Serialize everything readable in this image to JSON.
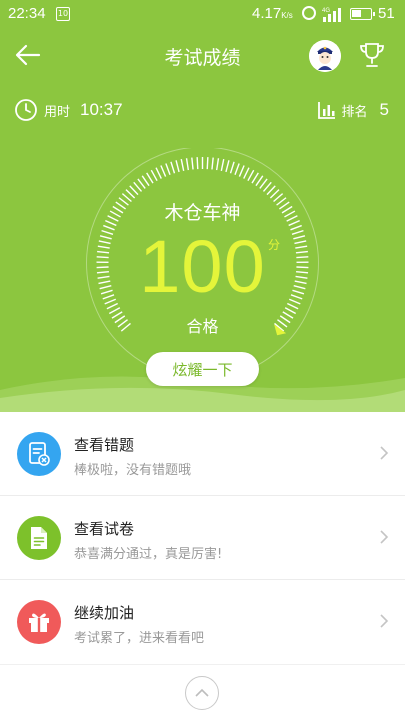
{
  "status_bar": {
    "time": "22:34",
    "notification_badge": "10",
    "speed": "4.17",
    "speed_unit": "K/s",
    "network": "4G",
    "battery_level": "51",
    "battery_percent": 51
  },
  "header": {
    "title": "考试成绩",
    "back_icon": "arrow-left-icon",
    "avatar_icon": "avatar",
    "trophy_icon": "trophy-icon"
  },
  "stats": {
    "time_label": "用时",
    "time_value": "10:37",
    "rank_label": "排名",
    "rank_value": "5"
  },
  "score": {
    "title": "木仓车神",
    "value": "100",
    "unit": "分",
    "status": "合格",
    "percent": 100
  },
  "share_button": "炫耀一下",
  "menu": [
    {
      "title": "查看错题",
      "subtitle": "棒极啦，没有错题哦",
      "icon": "error-list-icon",
      "color": "#34a5f0"
    },
    {
      "title": "查看试卷",
      "subtitle": "恭喜满分通过，真是厉害!",
      "icon": "document-icon",
      "color": "#7dc12b"
    },
    {
      "title": "继续加油",
      "subtitle": "考试累了，进来看看吧",
      "icon": "gift-icon",
      "color": "#f05a5a"
    }
  ],
  "colors": {
    "hero_green": "#8cc63f",
    "score_yellow": "#e4f53a"
  }
}
